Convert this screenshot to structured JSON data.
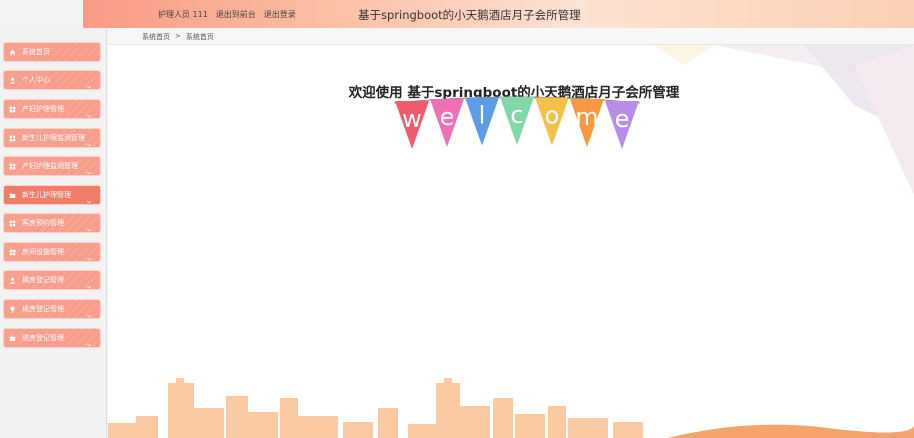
{
  "header": {
    "role_label": "护理人员 111",
    "back_to_front_label": "退出到前台",
    "logout_label": "退出登录",
    "system_title": "基于springboot的小天鹅酒店月子会所管理"
  },
  "breadcrumb": {
    "home": "系统首页",
    "separator": ">",
    "current": "系统首页"
  },
  "sidebar": {
    "items": [
      {
        "label": "系统首页",
        "icon": "home-icon",
        "has_chevron": false
      },
      {
        "label": "个人中心",
        "icon": "user-icon",
        "has_chevron": true
      },
      {
        "label": "产妇护理管理",
        "icon": "grid-icon",
        "has_chevron": true
      },
      {
        "label": "新生儿护理监测管理",
        "icon": "grid-icon",
        "has_chevron": true
      },
      {
        "label": "产妇护理监测管理",
        "icon": "grid-icon",
        "has_chevron": true
      },
      {
        "label": "新生儿护理管理",
        "icon": "folder-icon",
        "has_chevron": true
      },
      {
        "label": "客房预约管理",
        "icon": "grid-icon",
        "has_chevron": true
      },
      {
        "label": "房间设施管理",
        "icon": "grid-icon",
        "has_chevron": true
      },
      {
        "label": "换房登记管理",
        "icon": "user-icon",
        "has_chevron": true
      },
      {
        "label": "续房登记管理",
        "icon": "trophy-icon",
        "has_chevron": true
      },
      {
        "label": "退房登记管理",
        "icon": "briefcase-icon",
        "has_chevron": true
      }
    ]
  },
  "main": {
    "welcome_title": "欢迎使用 基于springboot的小天鹅酒店月子会所管理",
    "bunting_letters": [
      "w",
      "e",
      "l",
      "c",
      "o",
      "m",
      "e"
    ]
  },
  "colors": {
    "accent": "#f7a191",
    "accent_dark": "#f27c6a",
    "skyline": "#fbc9a2"
  }
}
